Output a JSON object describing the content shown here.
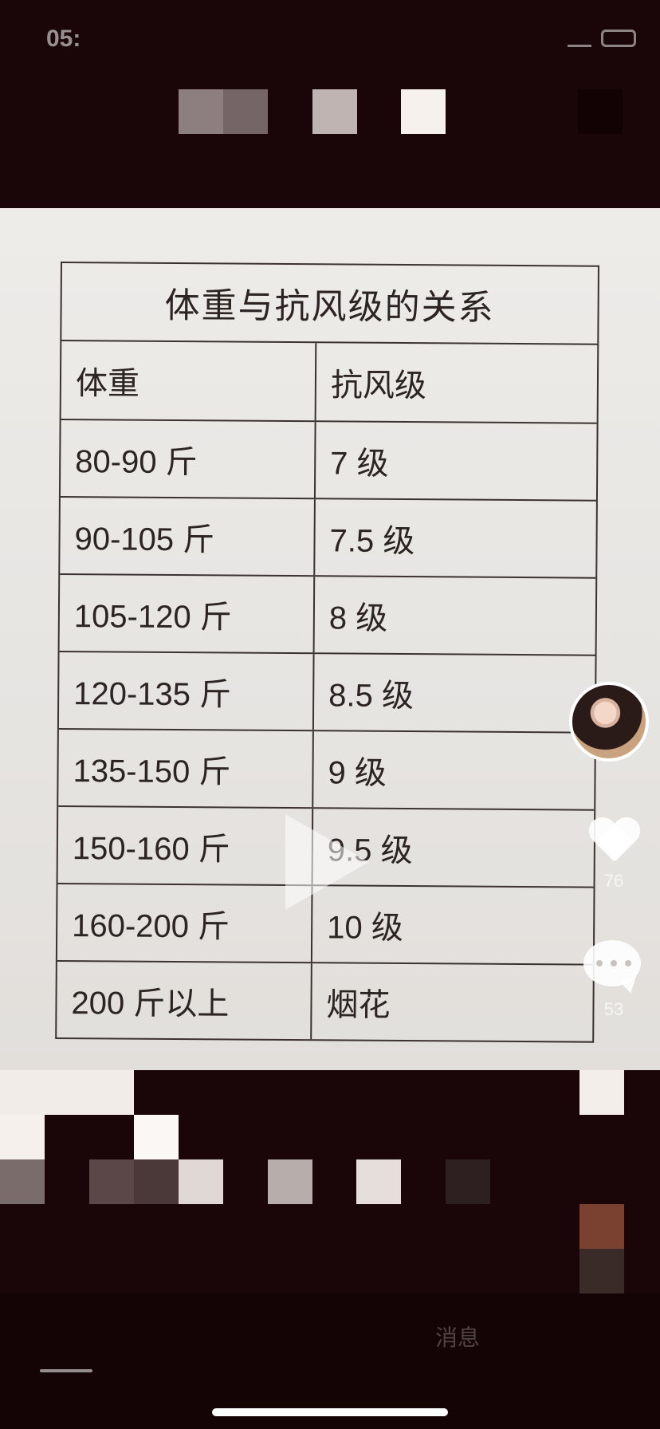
{
  "status_bar": {
    "time": "05:"
  },
  "table": {
    "title": "体重与抗风级的关系",
    "headers": {
      "weight": "体重",
      "level": "抗风级"
    },
    "rows": [
      {
        "weight": "80-90 斤",
        "level": "7 级"
      },
      {
        "weight": "90-105 斤",
        "level": "7.5 级"
      },
      {
        "weight": "105-120 斤",
        "level": "8 级"
      },
      {
        "weight": "120-135 斤",
        "level": "8.5 级"
      },
      {
        "weight": "135-150 斤",
        "level": "9 级"
      },
      {
        "weight": "150-160 斤",
        "level": "9.5 级"
      },
      {
        "weight": "160-200 斤",
        "level": "10 级"
      },
      {
        "weight": "200 斤以上",
        "level": "烟花"
      }
    ]
  },
  "actions": {
    "likes": "76",
    "comments": "53"
  },
  "bottom_nav": {
    "messages_label": "消息"
  },
  "colors": {
    "background": "#1a0608",
    "paper": "#e9e7e4",
    "ink": "#2c2422"
  }
}
